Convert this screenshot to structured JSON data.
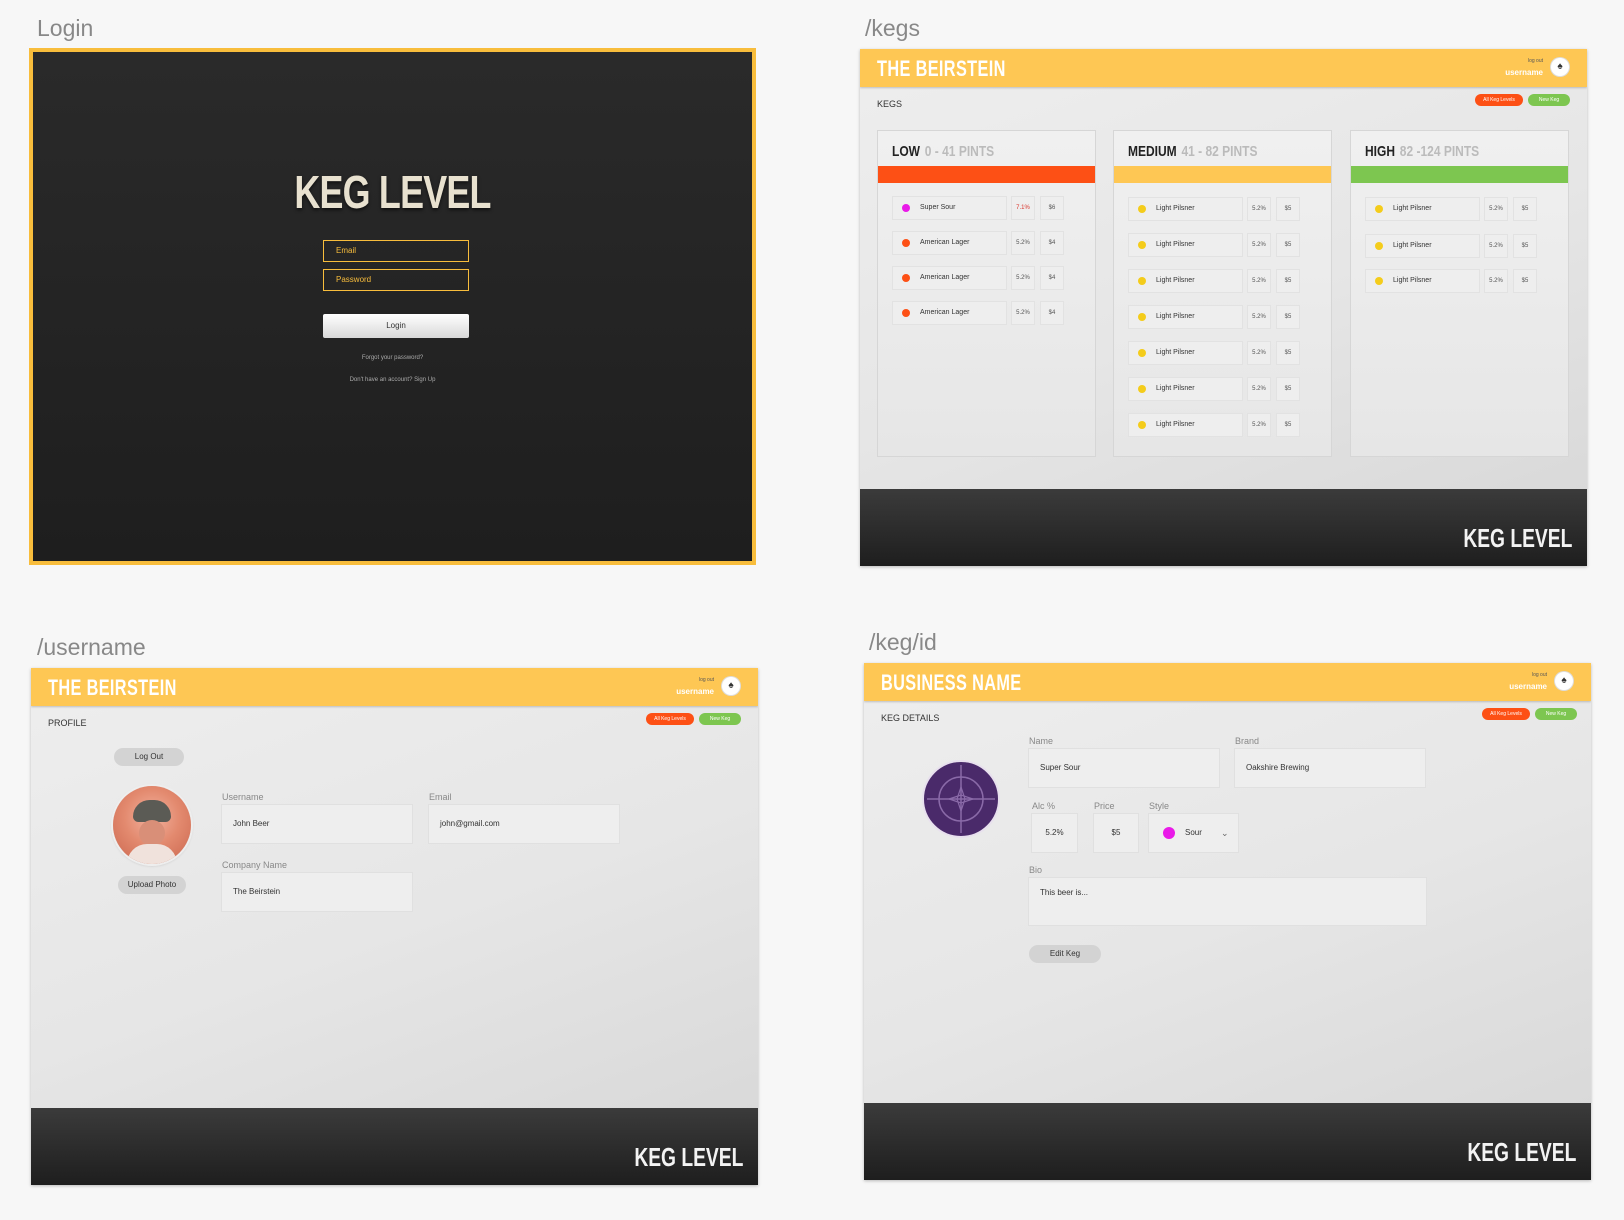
{
  "frames": {
    "login_title": "Login",
    "kegs_title": "/kegs",
    "username_title": "/username",
    "kegid_title": "/keg/id"
  },
  "login": {
    "brand": "KEG LEVEL",
    "email_placeholder": "Email",
    "password_placeholder": "Password",
    "login_button": "Login",
    "forgot_link": "Forgot your password?",
    "signup_link": "Don't have an account? Sign Up"
  },
  "header": {
    "logout": "log out",
    "username": "username",
    "all_keg_levels": "All Keg Levels",
    "new_keg": "New Keg",
    "footer_logo": "KEG LEVEL"
  },
  "kegs_page": {
    "business_name": "THE BEIRSTEIN",
    "section": "KEGS",
    "columns": [
      {
        "title": "LOW",
        "range": "0 - 41 PINTS",
        "bar_color": "#fd5015",
        "items": [
          {
            "name": "Super Sour",
            "abv": "7.1%",
            "price": "$6",
            "dot": "#e91ae8",
            "abv_color": "#d9342b"
          },
          {
            "name": "American Lager",
            "abv": "5.2%",
            "price": "$4",
            "dot": "#fd5015",
            "abv_color": "#555555"
          },
          {
            "name": "American Lager",
            "abv": "5.2%",
            "price": "$4",
            "dot": "#fd5015",
            "abv_color": "#555555"
          },
          {
            "name": "American Lager",
            "abv": "5.2%",
            "price": "$4",
            "dot": "#fd5015",
            "abv_color": "#555555"
          }
        ]
      },
      {
        "title": "MEDIUM",
        "range": "41 - 82 PINTS",
        "bar_color": "#fec754",
        "items": [
          {
            "name": "Light Pilsner",
            "abv": "5.2%",
            "price": "$5",
            "dot": "#f4cc1b",
            "abv_color": "#555555"
          },
          {
            "name": "Light Pilsner",
            "abv": "5.2%",
            "price": "$5",
            "dot": "#f4cc1b",
            "abv_color": "#555555"
          },
          {
            "name": "Light Pilsner",
            "abv": "5.2%",
            "price": "$5",
            "dot": "#f4cc1b",
            "abv_color": "#555555"
          },
          {
            "name": "Light Pilsner",
            "abv": "5.2%",
            "price": "$5",
            "dot": "#f4cc1b",
            "abv_color": "#555555"
          },
          {
            "name": "Light Pilsner",
            "abv": "5.2%",
            "price": "$5",
            "dot": "#f4cc1b",
            "abv_color": "#555555"
          },
          {
            "name": "Light Pilsner",
            "abv": "5.2%",
            "price": "$5",
            "dot": "#f4cc1b",
            "abv_color": "#555555"
          },
          {
            "name": "Light Pilsner",
            "abv": "5.2%",
            "price": "$5",
            "dot": "#f4cc1b",
            "abv_color": "#555555"
          }
        ]
      },
      {
        "title": "HIGH",
        "range": "82 -124 PINTS",
        "bar_color": "#7dc650",
        "items": [
          {
            "name": "Light Pilsner",
            "abv": "5.2%",
            "price": "$5",
            "dot": "#f4cc1b",
            "abv_color": "#555555"
          },
          {
            "name": "Light Pilsner",
            "abv": "5.2%",
            "price": "$5",
            "dot": "#f4cc1b",
            "abv_color": "#555555"
          },
          {
            "name": "Light Pilsner",
            "abv": "5.2%",
            "price": "$5",
            "dot": "#f4cc1b",
            "abv_color": "#555555"
          }
        ]
      }
    ]
  },
  "profile_page": {
    "business_name": "THE BEIRSTEIN",
    "section": "PROFILE",
    "logout_button": "Log Out",
    "upload_button": "Upload Photo",
    "username_label": "Username",
    "username_value": "John Beer",
    "email_label": "Email",
    "email_value": "john@gmail.com",
    "company_label": "Company Name",
    "company_value": "The Beirstein"
  },
  "keg_page": {
    "business_name": "BUSINESS NAME",
    "section": "KEG DETAILS",
    "name_label": "Name",
    "name_value": "Super  Sour",
    "brand_label": "Brand",
    "brand_value": "Oakshire Brewing",
    "alc_label": "Alc %",
    "alc_value": "5.2%",
    "price_label": "Price",
    "price_value": "$5",
    "style_label": "Style",
    "style_value": "Sour",
    "style_color": "#e91ae8",
    "bio_label": "Bio",
    "bio_value": "This beer is...",
    "edit_button": "Edit Keg"
  },
  "colors": {
    "accent": "#fec754",
    "low": "#fd5015",
    "high": "#7dc650",
    "login_border": "#f8bd3c",
    "keg_logo": "#4a2a6a"
  }
}
